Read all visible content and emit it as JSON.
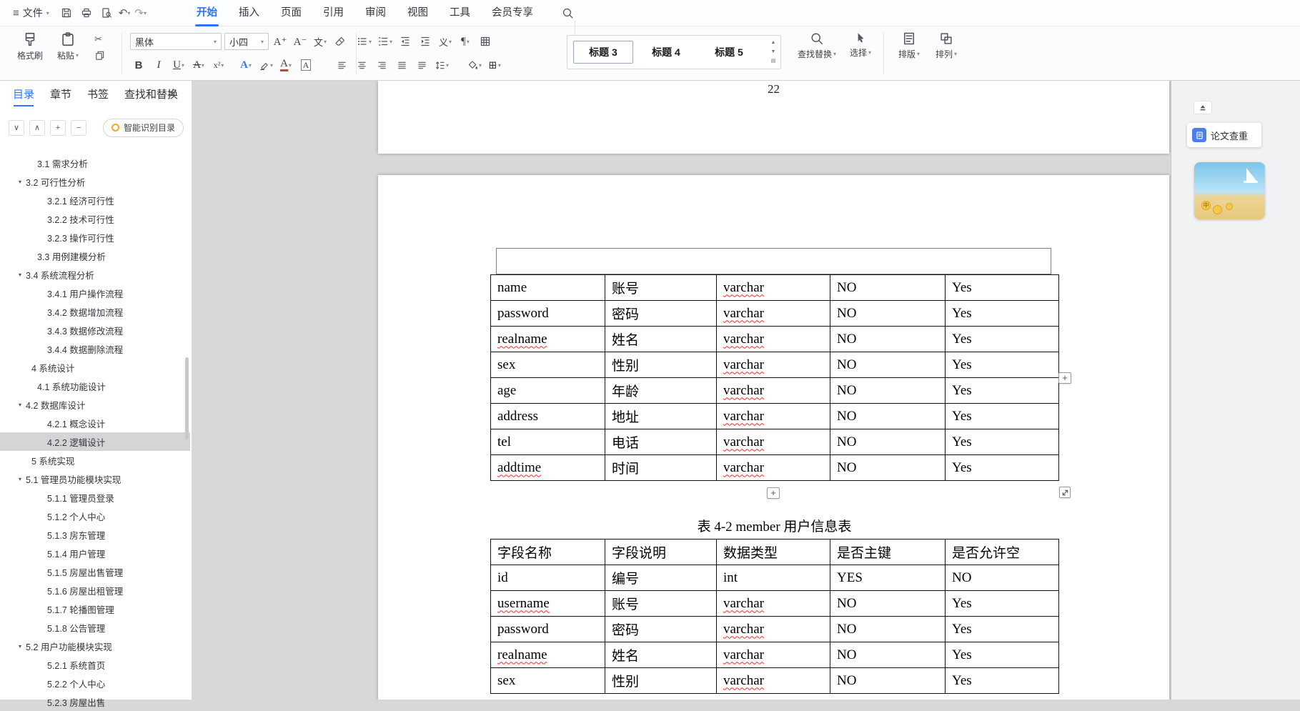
{
  "menubar": {
    "file_label": "文件",
    "tabs": [
      {
        "label": "开始",
        "active": true
      },
      {
        "label": "插入"
      },
      {
        "label": "页面"
      },
      {
        "label": "引用"
      },
      {
        "label": "审阅"
      },
      {
        "label": "视图"
      },
      {
        "label": "工具"
      },
      {
        "label": "会员专享"
      }
    ]
  },
  "toolbar": {
    "format_painter_label": "格式刷",
    "paste_label": "粘贴",
    "font_name": "黑体",
    "font_size": "小四",
    "styles": [
      {
        "label": "标题 3",
        "selected": true
      },
      {
        "label": "标题 4"
      },
      {
        "label": "标题 5"
      }
    ],
    "find_replace_label": "查找替换",
    "select_label": "选择",
    "layout_label": "排版",
    "arrange_label": "排列"
  },
  "icons": {
    "hamburger": "≡",
    "undo": "↶",
    "redo": "↷",
    "cut": "✂",
    "bold": "B",
    "italic": "I",
    "underline": "U",
    "strikethrough": "A",
    "superscript": "x²",
    "grow_font": "A⁺",
    "shrink_font": "A⁻",
    "phonetic": "文",
    "text_effect": "A",
    "font_color": "A",
    "char_border": "A",
    "paragraph_marks": "¶",
    "borders": "⊞",
    "chevron_down": "∨",
    "chevron_up": "∧",
    "plus": "+",
    "minus": "−",
    "close": "×",
    "toc_arrow": "▾",
    "gallery_up": "▲",
    "gallery_down": "▼",
    "gallery_more": "▤"
  },
  "sidebar": {
    "tabs": [
      {
        "label": "目录",
        "active": true
      },
      {
        "label": "章节"
      },
      {
        "label": "书签"
      },
      {
        "label": "查找和替换"
      }
    ],
    "smart_button_label": "智能识别目录",
    "toc": [
      {
        "label": "3.1 需求分析",
        "indent": 2
      },
      {
        "label": "3.2 可行性分析",
        "arrow": true
      },
      {
        "label": "3.2.1 经济可行性",
        "indent": 3
      },
      {
        "label": "3.2.2 技术可行性",
        "indent": 3
      },
      {
        "label": "3.2.3 操作可行性",
        "indent": 3
      },
      {
        "label": "3.3 用例建模分析",
        "indent": 2
      },
      {
        "label": "3.4 系统流程分析",
        "arrow": true
      },
      {
        "label": "3.4.1 用户操作流程",
        "indent": 3
      },
      {
        "label": "3.4.2 数据增加流程",
        "indent": 3
      },
      {
        "label": "3.4.3 数据修改流程",
        "indent": 3
      },
      {
        "label": "3.4.4 数据删除流程",
        "indent": 3
      },
      {
        "label": "4 系统设计",
        "indent": 1
      },
      {
        "label": "4.1 系统功能设计",
        "indent": 2
      },
      {
        "label": "4.2 数据库设计",
        "arrow": true
      },
      {
        "label": "4.2.1 概念设计",
        "indent": 3
      },
      {
        "label": "4.2.2 逻辑设计",
        "indent": 3,
        "selected": true
      },
      {
        "label": "5 系统实现",
        "indent": 1
      },
      {
        "label": "5.1 管理员功能模块实现",
        "arrow": true
      },
      {
        "label": "5.1.1 管理员登录",
        "indent": 3
      },
      {
        "label": "5.1.2 个人中心",
        "indent": 3
      },
      {
        "label": "5.1.3 房东管理",
        "indent": 3
      },
      {
        "label": "5.1.4 用户管理",
        "indent": 3
      },
      {
        "label": "5.1.5 房屋出售管理",
        "indent": 3
      },
      {
        "label": "5.1.6 房屋出租管理",
        "indent": 3
      },
      {
        "label": "5.1.7 轮播图管理",
        "indent": 3
      },
      {
        "label": "5.1.8 公告管理",
        "indent": 3
      },
      {
        "label": "5.2 用户功能模块实现",
        "arrow": true
      },
      {
        "label": "5.2.1 系统首页",
        "indent": 3
      },
      {
        "label": "5.2.2 个人中心",
        "indent": 3
      },
      {
        "label": "5.2.3 房屋出售",
        "indent": 3
      }
    ]
  },
  "document": {
    "page_number": "22",
    "table1": {
      "rows": [
        [
          "name",
          "账号",
          "varchar",
          "NO",
          "Yes"
        ],
        [
          "password",
          "密码",
          "varchar",
          "NO",
          "Yes"
        ],
        [
          "realname",
          "姓名",
          "varchar",
          "NO",
          "Yes"
        ],
        [
          "sex",
          "性别",
          "varchar",
          "NO",
          "Yes"
        ],
        [
          "age",
          "年龄",
          "varchar",
          "NO",
          "Yes"
        ],
        [
          "address",
          "地址",
          "varchar",
          "NO",
          "Yes"
        ],
        [
          "tel",
          "电话",
          "varchar",
          "NO",
          "Yes"
        ],
        [
          "addtime",
          "时间",
          "varchar",
          "NO",
          "Yes"
        ]
      ]
    },
    "caption": "表 4-2 member 用户信息表",
    "table2": {
      "headers": [
        "字段名称",
        "字段说明",
        "数据类型",
        "是否主键",
        "是否允许空"
      ],
      "rows": [
        [
          "id",
          "编号",
          "int",
          "YES",
          "NO"
        ],
        [
          "username",
          "账号",
          "varchar",
          "NO",
          "Yes"
        ],
        [
          "password",
          "密码",
          "varchar",
          "NO",
          "Yes"
        ],
        [
          "realname",
          "姓名",
          "varchar",
          "NO",
          "Yes"
        ],
        [
          "sex",
          "性别",
          "varchar",
          "NO",
          "Yes"
        ]
      ]
    },
    "misspelled": [
      "varchar",
      "realname",
      "addtime",
      "username"
    ]
  },
  "right_panel": {
    "paper_check_label": "论文查重",
    "ad_coin": "中"
  }
}
